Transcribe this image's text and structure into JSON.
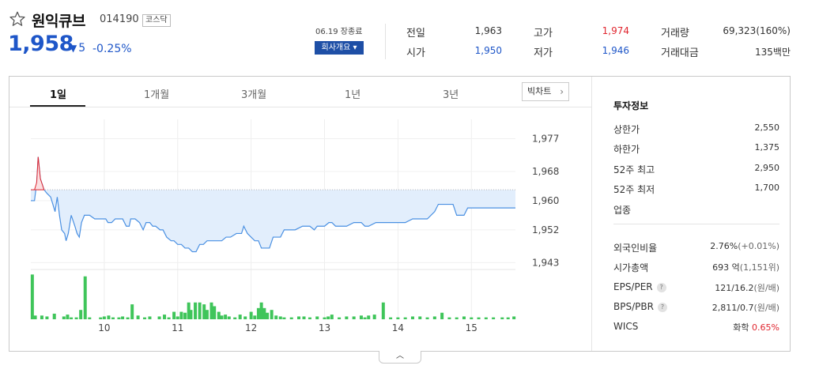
{
  "header": {
    "name": "원익큐브",
    "code": "014190",
    "market": "코스닥",
    "price": "1,958",
    "change_arrow": "▼",
    "change": "5",
    "rate": "-0.25%",
    "date_status": "06.19 장종료",
    "company_button": "회사개요 ▾"
  },
  "quote": {
    "prev_label": "전일",
    "prev": "1,963",
    "open_label": "시가",
    "open": "1,950",
    "high_label": "고가",
    "high": "1,974",
    "low_label": "저가",
    "low": "1,946",
    "volume_label": "거래량",
    "volume": "69,323(160%)",
    "amount_label": "거래대금",
    "amount": "135백만"
  },
  "tabs": [
    "1일",
    "1개월",
    "3개월",
    "1년",
    "3년"
  ],
  "bigchart_label": "빅차트",
  "info": {
    "title": "투자정보",
    "upper_label": "상한가",
    "upper": "2,550",
    "lower_label": "하한가",
    "lower": "1,375",
    "w52_high_label": "52주 최고",
    "w52_high": "2,950",
    "w52_low_label": "52주 최저",
    "w52_low": "1,700",
    "sector_label": "업종",
    "foreign_label": "외국인비율",
    "foreign": "2.76%",
    "foreign_change": "(+0.01%)",
    "mcap_label": "시가총액",
    "mcap": "693 억",
    "mcap_sub": "(1,151위)",
    "eps_label": "EPS/PER",
    "eps": "121/16.2",
    "eps_unit": "(원/배)",
    "bps_label": "BPS/PBR",
    "bps": "2,811/0.7",
    "bps_unit": "(원/배)",
    "wics_label": "WICS",
    "wics": "화학",
    "wics_rate": "0.65%"
  },
  "colors": {
    "up": "#e0262f",
    "down": "#1e56c8",
    "volume": "#3fc55a",
    "line": "#4a90e2",
    "fill": "#e2eefc"
  },
  "chart_data": {
    "type": "line",
    "y_ticks": [
      1977,
      1968,
      1960,
      1952,
      1943
    ],
    "ylim": [
      1942,
      1981
    ],
    "baseline": 1963,
    "x_labels": [
      "10",
      "11",
      "12",
      "13",
      "14",
      "15"
    ],
    "x_label_positions": [
      1,
      2,
      3,
      4,
      5,
      6
    ],
    "x_range": [
      0,
      6.6
    ],
    "price": [
      [
        0.0,
        1960
      ],
      [
        0.05,
        1960
      ],
      [
        0.08,
        1965
      ],
      [
        0.1,
        1972
      ],
      [
        0.13,
        1966
      ],
      [
        0.18,
        1963
      ],
      [
        0.22,
        1962
      ],
      [
        0.27,
        1961
      ],
      [
        0.3,
        1959
      ],
      [
        0.33,
        1957
      ],
      [
        0.36,
        1961
      ],
      [
        0.39,
        1956
      ],
      [
        0.42,
        1952
      ],
      [
        0.46,
        1951
      ],
      [
        0.48,
        1949
      ],
      [
        0.51,
        1951
      ],
      [
        0.55,
        1956
      ],
      [
        0.6,
        1953
      ],
      [
        0.63,
        1951
      ],
      [
        0.66,
        1950
      ],
      [
        0.69,
        1954
      ],
      [
        0.73,
        1956
      ],
      [
        0.8,
        1956
      ],
      [
        0.87,
        1955
      ],
      [
        0.95,
        1955
      ],
      [
        1.02,
        1955
      ],
      [
        1.05,
        1954
      ],
      [
        1.1,
        1954
      ],
      [
        1.15,
        1955
      ],
      [
        1.2,
        1955
      ],
      [
        1.25,
        1955
      ],
      [
        1.3,
        1953
      ],
      [
        1.34,
        1953
      ],
      [
        1.36,
        1955
      ],
      [
        1.42,
        1955
      ],
      [
        1.48,
        1954
      ],
      [
        1.53,
        1952
      ],
      [
        1.57,
        1954
      ],
      [
        1.62,
        1954
      ],
      [
        1.66,
        1953
      ],
      [
        1.7,
        1953
      ],
      [
        1.76,
        1952
      ],
      [
        1.8,
        1952
      ],
      [
        1.85,
        1950
      ],
      [
        1.91,
        1949
      ],
      [
        1.95,
        1949
      ],
      [
        2.0,
        1948
      ],
      [
        2.05,
        1948
      ],
      [
        2.1,
        1947
      ],
      [
        2.15,
        1947
      ],
      [
        2.2,
        1946
      ],
      [
        2.25,
        1946
      ],
      [
        2.3,
        1948
      ],
      [
        2.35,
        1948
      ],
      [
        2.4,
        1949
      ],
      [
        2.5,
        1949
      ],
      [
        2.6,
        1949
      ],
      [
        2.66,
        1950
      ],
      [
        2.72,
        1950
      ],
      [
        2.8,
        1951
      ],
      [
        2.87,
        1951
      ],
      [
        2.9,
        1953
      ],
      [
        2.95,
        1951
      ],
      [
        3.0,
        1950
      ],
      [
        3.05,
        1949
      ],
      [
        3.1,
        1949
      ],
      [
        3.14,
        1947
      ],
      [
        3.2,
        1947
      ],
      [
        3.25,
        1947
      ],
      [
        3.3,
        1950
      ],
      [
        3.4,
        1950
      ],
      [
        3.45,
        1952
      ],
      [
        3.5,
        1952
      ],
      [
        3.6,
        1952
      ],
      [
        3.7,
        1953
      ],
      [
        3.8,
        1953
      ],
      [
        3.86,
        1952
      ],
      [
        3.9,
        1953
      ],
      [
        4.0,
        1953
      ],
      [
        4.06,
        1954
      ],
      [
        4.1,
        1954
      ],
      [
        4.15,
        1953
      ],
      [
        4.2,
        1953
      ],
      [
        4.3,
        1953
      ],
      [
        4.4,
        1954
      ],
      [
        4.5,
        1954
      ],
      [
        4.55,
        1953
      ],
      [
        4.6,
        1953
      ],
      [
        4.7,
        1954
      ],
      [
        4.8,
        1954
      ],
      [
        4.9,
        1954
      ],
      [
        5.0,
        1954
      ],
      [
        5.1,
        1954
      ],
      [
        5.2,
        1955
      ],
      [
        5.3,
        1955
      ],
      [
        5.4,
        1955
      ],
      [
        5.5,
        1957
      ],
      [
        5.55,
        1959
      ],
      [
        5.65,
        1959
      ],
      [
        5.75,
        1959
      ],
      [
        5.8,
        1956
      ],
      [
        5.9,
        1956
      ],
      [
        5.95,
        1958
      ],
      [
        6.0,
        1958
      ],
      [
        6.2,
        1958
      ],
      [
        6.4,
        1958
      ],
      [
        6.6,
        1958
      ]
    ],
    "volume": [
      [
        0.02,
        48
      ],
      [
        0.06,
        4
      ],
      [
        0.15,
        4
      ],
      [
        0.22,
        3
      ],
      [
        0.32,
        6
      ],
      [
        0.45,
        3
      ],
      [
        0.5,
        5
      ],
      [
        0.55,
        2
      ],
      [
        0.62,
        2
      ],
      [
        0.68,
        10
      ],
      [
        0.74,
        46
      ],
      [
        0.8,
        2
      ],
      [
        0.95,
        2
      ],
      [
        1.0,
        3
      ],
      [
        1.06,
        4
      ],
      [
        1.12,
        2
      ],
      [
        1.2,
        2
      ],
      [
        1.25,
        3
      ],
      [
        1.32,
        2
      ],
      [
        1.38,
        16
      ],
      [
        1.46,
        4
      ],
      [
        1.55,
        2
      ],
      [
        1.62,
        3
      ],
      [
        1.75,
        3
      ],
      [
        1.82,
        5
      ],
      [
        1.88,
        2
      ],
      [
        1.95,
        8
      ],
      [
        2.0,
        3
      ],
      [
        2.05,
        8
      ],
      [
        2.1,
        7
      ],
      [
        2.15,
        18
      ],
      [
        2.18,
        10
      ],
      [
        2.24,
        18
      ],
      [
        2.3,
        18
      ],
      [
        2.36,
        16
      ],
      [
        2.4,
        10
      ],
      [
        2.46,
        18
      ],
      [
        2.5,
        14
      ],
      [
        2.56,
        8
      ],
      [
        2.6,
        4
      ],
      [
        2.65,
        5
      ],
      [
        2.7,
        3
      ],
      [
        2.78,
        2
      ],
      [
        2.85,
        5
      ],
      [
        2.92,
        3
      ],
      [
        3.0,
        8
      ],
      [
        3.05,
        4
      ],
      [
        3.1,
        12
      ],
      [
        3.14,
        18
      ],
      [
        3.18,
        12
      ],
      [
        3.22,
        7
      ],
      [
        3.28,
        10
      ],
      [
        3.34,
        4
      ],
      [
        3.4,
        3
      ],
      [
        3.45,
        2
      ],
      [
        3.55,
        2
      ],
      [
        3.65,
        3
      ],
      [
        3.72,
        3
      ],
      [
        3.8,
        2
      ],
      [
        3.9,
        3
      ],
      [
        4.0,
        2
      ],
      [
        4.05,
        3
      ],
      [
        4.1,
        5
      ],
      [
        4.2,
        2
      ],
      [
        4.3,
        3
      ],
      [
        4.4,
        3
      ],
      [
        4.5,
        4
      ],
      [
        4.55,
        2
      ],
      [
        4.6,
        4
      ],
      [
        4.68,
        5
      ],
      [
        4.8,
        18
      ],
      [
        4.9,
        2
      ],
      [
        5.0,
        2
      ],
      [
        5.1,
        2
      ],
      [
        5.2,
        3
      ],
      [
        5.3,
        3
      ],
      [
        5.4,
        2
      ],
      [
        5.5,
        3
      ],
      [
        5.6,
        7
      ],
      [
        5.7,
        2
      ],
      [
        5.8,
        2
      ],
      [
        5.9,
        3
      ],
      [
        6.0,
        2
      ],
      [
        6.1,
        2
      ],
      [
        6.2,
        2
      ],
      [
        6.3,
        2
      ],
      [
        6.42,
        2
      ],
      [
        6.5,
        2
      ],
      [
        6.58,
        3
      ]
    ],
    "volume_max": 50
  }
}
